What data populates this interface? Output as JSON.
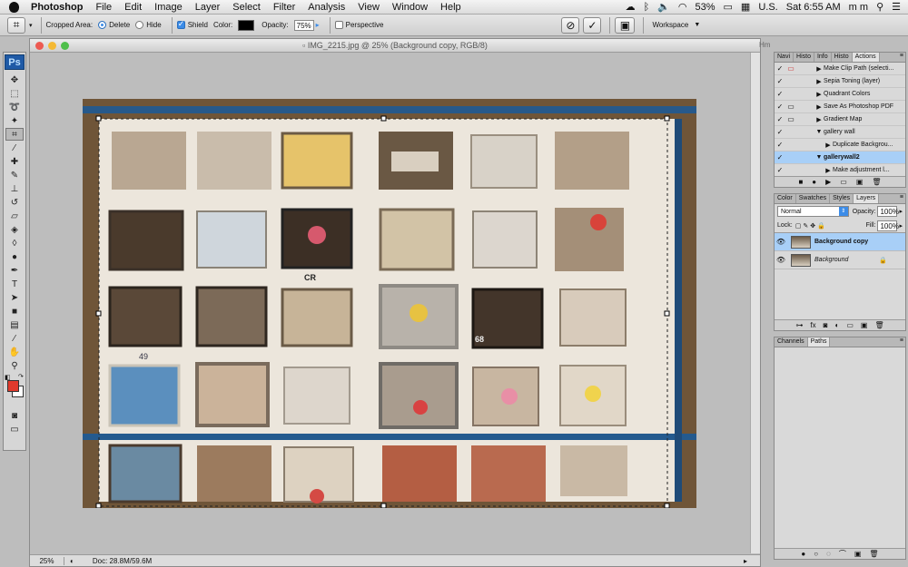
{
  "menubar": {
    "app": "Photoshop",
    "items": [
      "File",
      "Edit",
      "Image",
      "Layer",
      "Select",
      "Filter",
      "Analysis",
      "View",
      "Window",
      "Help"
    ],
    "battery": "53%",
    "input": "U.S.",
    "time": "Sat 6:55 AM",
    "user": "m m"
  },
  "options": {
    "cropped_area_label": "Cropped Area:",
    "delete_label": "Delete",
    "hide_label": "Hide",
    "shield_label": "Shield",
    "color_label": "Color:",
    "opacity_label": "Opacity:",
    "opacity_value": "75%",
    "perspective_label": "Perspective",
    "workspace_label": "Workspace"
  },
  "document": {
    "title": "IMG_2215.jpg @ 25% (Background copy, RGB/8)",
    "zoom": "25%",
    "doc_size": "Doc: 28.8M/59.6M",
    "side_label": "Hm"
  },
  "actions_panel": {
    "tabs": [
      "Navi",
      "Histo",
      "Info",
      "Histo",
      "Actions"
    ],
    "rows": [
      {
        "label": "Make Clip Path (selecti...",
        "depth": 2,
        "hl": false
      },
      {
        "label": "Sepia Toning (layer)",
        "depth": 2,
        "hl": false
      },
      {
        "label": "Quadrant Colors",
        "depth": 2,
        "hl": false
      },
      {
        "label": "Save As Photoshop PDF",
        "depth": 2,
        "hl": false
      },
      {
        "label": "Gradient Map",
        "depth": 2,
        "hl": false
      },
      {
        "label": "gallery wall",
        "depth": 1,
        "hl": false
      },
      {
        "label": "Duplicate Backgrou...",
        "depth": 3,
        "hl": false
      },
      {
        "label": "gallerywall2",
        "depth": 1,
        "hl": true
      },
      {
        "label": "Make adjustment l...",
        "depth": 3,
        "hl": false
      }
    ]
  },
  "layers_panel": {
    "tabs": [
      "Color",
      "Swatches",
      "Styles",
      "Layers"
    ],
    "blend_mode": "Normal",
    "opacity_label": "Opacity:",
    "opacity_value": "100%",
    "lock_label": "Lock:",
    "fill_label": "Fill:",
    "fill_value": "100%",
    "layers": [
      {
        "name": "Background copy",
        "hl": true
      },
      {
        "name": "Background",
        "hl": false
      }
    ]
  },
  "paths_panel": {
    "tabs": [
      "Channels",
      "Paths"
    ]
  },
  "photo_labels": [
    "CR",
    "49",
    "68"
  ],
  "colors": {
    "foreground": "#e03a2c",
    "background": "#ffffff",
    "accent": "#3c8ce8"
  }
}
